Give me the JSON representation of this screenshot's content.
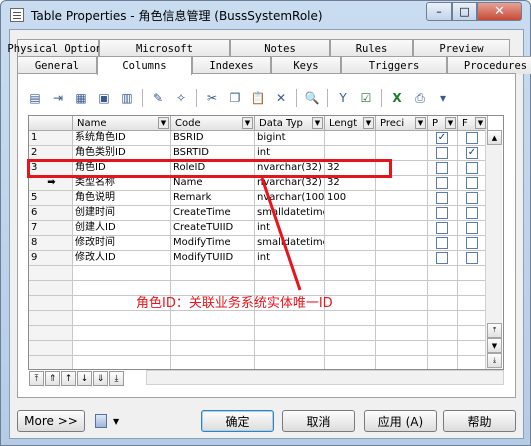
{
  "window": {
    "title": "Table Properties - 角色信息管理 (BussSystemRole)",
    "minimize": "–",
    "maximize": "□",
    "close": "✕"
  },
  "tabs_row1": [
    "Physical Options",
    "Microsoft",
    "Notes",
    "Rules",
    "Preview"
  ],
  "tabs_row2": [
    "General",
    "Columns",
    "Indexes",
    "Keys",
    "Triggers",
    "Procedures"
  ],
  "active_tab": "Columns",
  "toolbar": [
    "properties-icon",
    "insert-row-icon",
    "add-row-icon",
    "add-columns-icon",
    "delete-columns-icon",
    "new-icon",
    "paste-special-icon",
    "cut-icon",
    "copy-icon",
    "paste-icon",
    "delete-icon",
    "find-icon",
    "filter-icon",
    "customize-columns-icon",
    "excel-icon",
    "print-icon",
    "dropdown-icon"
  ],
  "grid": {
    "headers": [
      "Name",
      "Code",
      "Data Typ",
      "Lengt",
      "Preci",
      "P",
      "F"
    ],
    "rows": [
      {
        "num": "1",
        "name": "系统角色ID",
        "code": "BSRID",
        "type": "bigint",
        "length": "",
        "p": true,
        "f": false
      },
      {
        "num": "2",
        "name": "角色类别ID",
        "code": "BSRTID",
        "type": "int",
        "length": "",
        "p": false,
        "f": true
      },
      {
        "num": "3",
        "name": "角色ID",
        "code": "RoleID",
        "type": "nvarchar(32)",
        "length": "32",
        "p": false,
        "f": false
      },
      {
        "num": "➡",
        "name": "类型名称",
        "code": "Name",
        "type": "nvarchar(32)",
        "length": "32",
        "p": false,
        "f": false
      },
      {
        "num": "5",
        "name": "角色说明",
        "code": "Remark",
        "type": "nvarchar(100",
        "length": "100",
        "p": false,
        "f": false
      },
      {
        "num": "6",
        "name": "创建时间",
        "code": "CreateTime",
        "type": "smalldatetime",
        "length": "",
        "p": false,
        "f": false
      },
      {
        "num": "7",
        "name": "创建人ID",
        "code": "CreateTUIID",
        "type": "int",
        "length": "",
        "p": false,
        "f": false
      },
      {
        "num": "8",
        "name": "修改时间",
        "code": "ModifyTime",
        "type": "smalldatetime",
        "length": "",
        "p": false,
        "f": false
      },
      {
        "num": "9",
        "name": "修改人ID",
        "code": "ModifyTUIID",
        "type": "int",
        "length": "",
        "p": false,
        "f": false
      }
    ]
  },
  "annotation": "角色ID：关联业务系统实体唯一ID",
  "nav_buttons": [
    "⤒",
    "⇑",
    "↑",
    "↓",
    "⇓",
    "⤓"
  ],
  "buttons": {
    "more": "More >>",
    "ok": "确定",
    "cancel": "取消",
    "apply": "应用 (A)",
    "help": "帮助"
  }
}
